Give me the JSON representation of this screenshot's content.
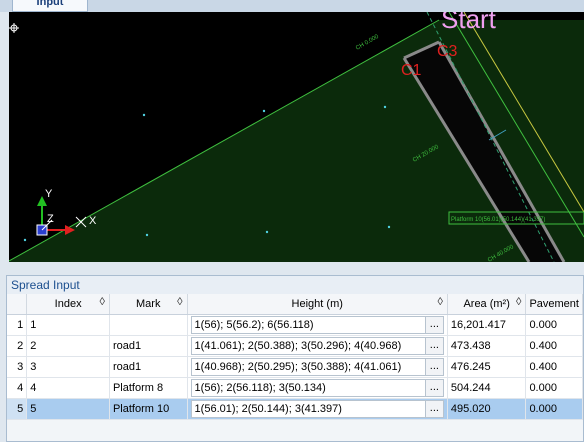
{
  "tab": {
    "label": "Input"
  },
  "viewport": {
    "start_label": "Start",
    "c1_label": "C1",
    "c3_label": "C3",
    "chainage_0": "CH 0.000",
    "chainage_20": "CH 20.000",
    "chainage_40": "CH 40.000",
    "platform_annotation": "Platform 10(56.01)(50.144)(41.397)",
    "axis_y": "Y",
    "axis_z": "Z",
    "axis_x": "X",
    "colors": {
      "background": "#000000",
      "fill": "#0b2a0b",
      "road_edge": "#8a8a8a",
      "label_pink": "#f0a0f0",
      "label_red": "#e02020"
    }
  },
  "spread": {
    "title": "Spread Input",
    "columns": [
      "Index",
      "Mark",
      "Height (m)",
      "Area (m²)",
      "Pavement"
    ],
    "selected_row": 4,
    "rows": [
      {
        "num": "1",
        "index": "1",
        "mark": "",
        "height": "1(56); 5(56.2); 6(56.118)",
        "area": "16,201.417",
        "pavement": "0.000"
      },
      {
        "num": "2",
        "index": "2",
        "mark": "road1",
        "height": "1(41.061); 2(50.388); 3(50.296); 4(40.968)",
        "area": "473.438",
        "pavement": "0.400"
      },
      {
        "num": "3",
        "index": "3",
        "mark": "road1",
        "height": "1(40.968); 2(50.295); 3(50.388); 4(41.061)",
        "area": "476.245",
        "pavement": "0.400"
      },
      {
        "num": "4",
        "index": "4",
        "mark": "Platform 8",
        "height": "1(56); 2(56.118); 3(50.134)",
        "area": "504.244",
        "pavement": "0.000"
      },
      {
        "num": "5",
        "index": "5",
        "mark": "Platform 10",
        "height": "1(56.01); 2(50.144); 3(41.397)",
        "area": "495.020",
        "pavement": "0.000"
      }
    ],
    "ellipsis": "...",
    "sort_icon": "◊"
  }
}
